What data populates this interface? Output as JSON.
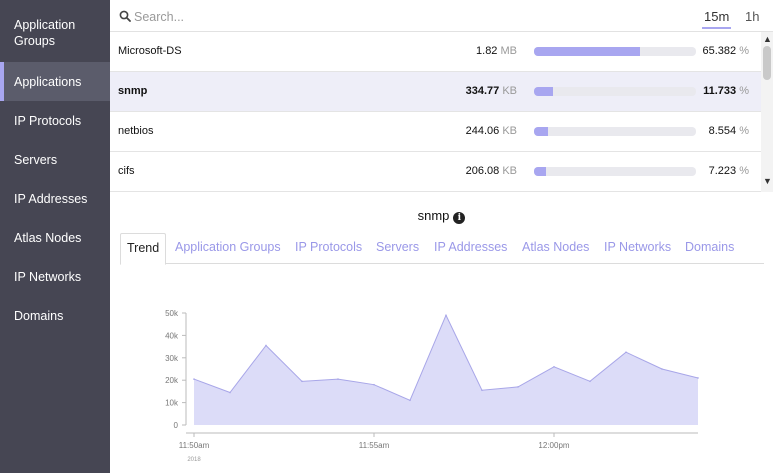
{
  "sidebar": {
    "items": [
      {
        "label": "Application Groups",
        "active": false
      },
      {
        "label": "Applications",
        "active": true
      },
      {
        "label": "IP Protocols",
        "active": false
      },
      {
        "label": "Servers",
        "active": false
      },
      {
        "label": "IP Addresses",
        "active": false
      },
      {
        "label": "Atlas Nodes",
        "active": false
      },
      {
        "label": "IP Networks",
        "active": false
      },
      {
        "label": "Domains",
        "active": false
      }
    ]
  },
  "topbar": {
    "search_placeholder": "Search...",
    "search_icon": "search-icon",
    "ranges": [
      "15m",
      "1h"
    ],
    "selected_range": "15m"
  },
  "table": {
    "rows": [
      {
        "name": "Microsoft-DS",
        "size": "1.82",
        "unit": "MB",
        "percent": "65.382",
        "fraction": 0.65382,
        "selected": false
      },
      {
        "name": "snmp",
        "size": "334.77",
        "unit": "KB",
        "percent": "11.733",
        "fraction": 0.11733,
        "selected": true
      },
      {
        "name": "netbios",
        "size": "244.06",
        "unit": "KB",
        "percent": "8.554",
        "fraction": 0.08554,
        "selected": false
      },
      {
        "name": "cifs",
        "size": "206.08",
        "unit": "KB",
        "percent": "7.223",
        "fraction": 0.07223,
        "selected": false
      }
    ],
    "percent_symbol": "%"
  },
  "detail": {
    "title": "snmp",
    "info_icon": "info-icon",
    "tabs": [
      "Trend",
      "Application Groups",
      "IP Protocols",
      "Servers",
      "IP Addresses",
      "Atlas Nodes",
      "IP Networks",
      "Domains"
    ],
    "active_tab": "Trend"
  },
  "chart_data": {
    "type": "area",
    "x": [
      "11:50",
      "11:51",
      "11:52",
      "11:53",
      "11:54",
      "11:55",
      "11:56",
      "11:57",
      "11:58",
      "11:59",
      "12:00",
      "12:01",
      "12:02",
      "12:03",
      "12:04"
    ],
    "values": [
      20500,
      14500,
      35500,
      19500,
      20500,
      18000,
      11000,
      49000,
      15500,
      17000,
      26000,
      19500,
      32500,
      25000,
      21000
    ],
    "ylim": [
      0,
      50000
    ],
    "yticks": [
      "0",
      "10k",
      "20k",
      "30k",
      "40k",
      "50k"
    ],
    "xticks": [
      {
        "label": "11:50am",
        "sublabel": "2018",
        "x": "11:50"
      },
      {
        "label": "11:55am",
        "sublabel": "",
        "x": "11:55"
      },
      {
        "label": "12:00pm",
        "sublabel": "",
        "x": "12:00"
      }
    ],
    "colors": {
      "fill": "#dcdcf8",
      "line": "#a8a6e8"
    },
    "grid": false
  }
}
